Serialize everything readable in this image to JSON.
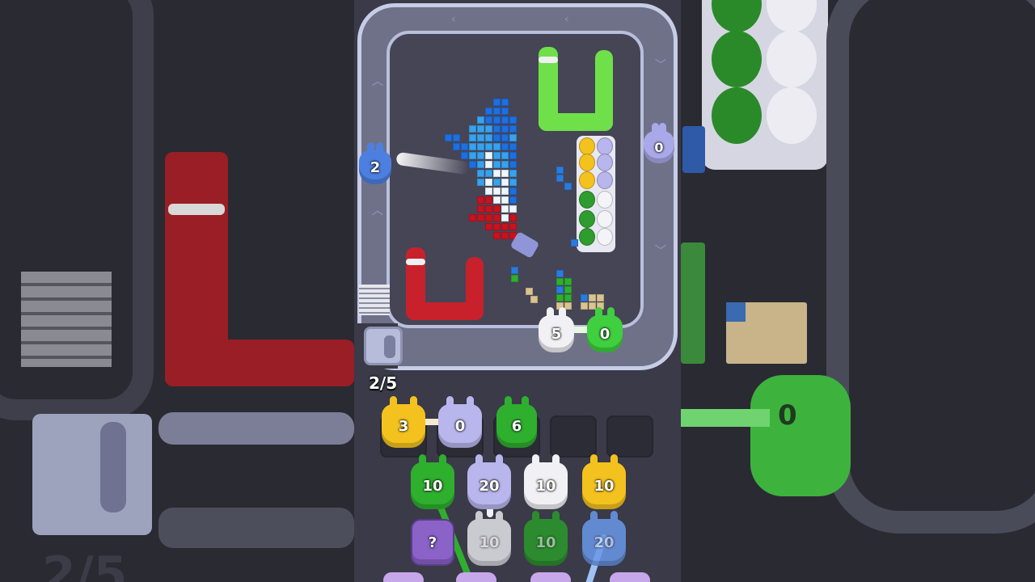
{
  "level_progress": "2/5",
  "conveyor_bunnies": [
    {
      "color": "blue",
      "hex": "#4d7fe0",
      "count": "2"
    },
    {
      "color": "lavender",
      "hex": "#a9a8e8",
      "count": "0"
    },
    {
      "color": "white",
      "hex": "#f1f1f5",
      "count": "5"
    },
    {
      "color": "green",
      "hex": "#3fcf3f",
      "count": "0"
    }
  ],
  "holding_slots": [
    {
      "color": "yellow",
      "hex": "#f4c21e",
      "count": "3"
    },
    {
      "color": "lavender",
      "hex": "#b8b6ec",
      "count": "0"
    },
    {
      "color": "green",
      "hex": "#2eaf2e",
      "count": "6"
    },
    {
      "color": "empty",
      "hex": "",
      "count": ""
    },
    {
      "color": "empty",
      "hex": "",
      "count": ""
    }
  ],
  "queue_rows": [
    [
      {
        "color": "green",
        "hex": "#2eaf2e",
        "count": "10"
      },
      {
        "color": "lavender",
        "hex": "#b8b6ec",
        "count": "20"
      },
      {
        "color": "white",
        "hex": "#f1f1f5",
        "count": "10"
      },
      {
        "color": "yellow",
        "hex": "#f4c21e",
        "count": "10"
      }
    ],
    [
      {
        "color": "mystery",
        "hex": "#8a62c8",
        "count": "?"
      },
      {
        "color": "white",
        "hex": "#e4e4ea",
        "count": "10"
      },
      {
        "color": "green",
        "hex": "#2a9a2a",
        "count": "10"
      },
      {
        "color": "blue",
        "hex": "#6a98ea",
        "count": "20"
      }
    ]
  ]
}
